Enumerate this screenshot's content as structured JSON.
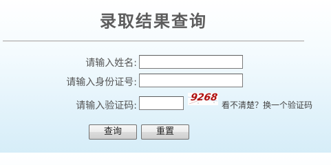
{
  "page": {
    "title": "录取结果查询"
  },
  "form": {
    "name_label": "请输入姓名:",
    "name_value": "",
    "id_label": "请输入身份证号:",
    "id_value": "",
    "code_label": "请输入验证码:",
    "code_value": "",
    "captcha_text": "9268",
    "refresh_link": "看不清楚？换一个验证码",
    "query_button": "查询",
    "reset_button": "重置"
  }
}
